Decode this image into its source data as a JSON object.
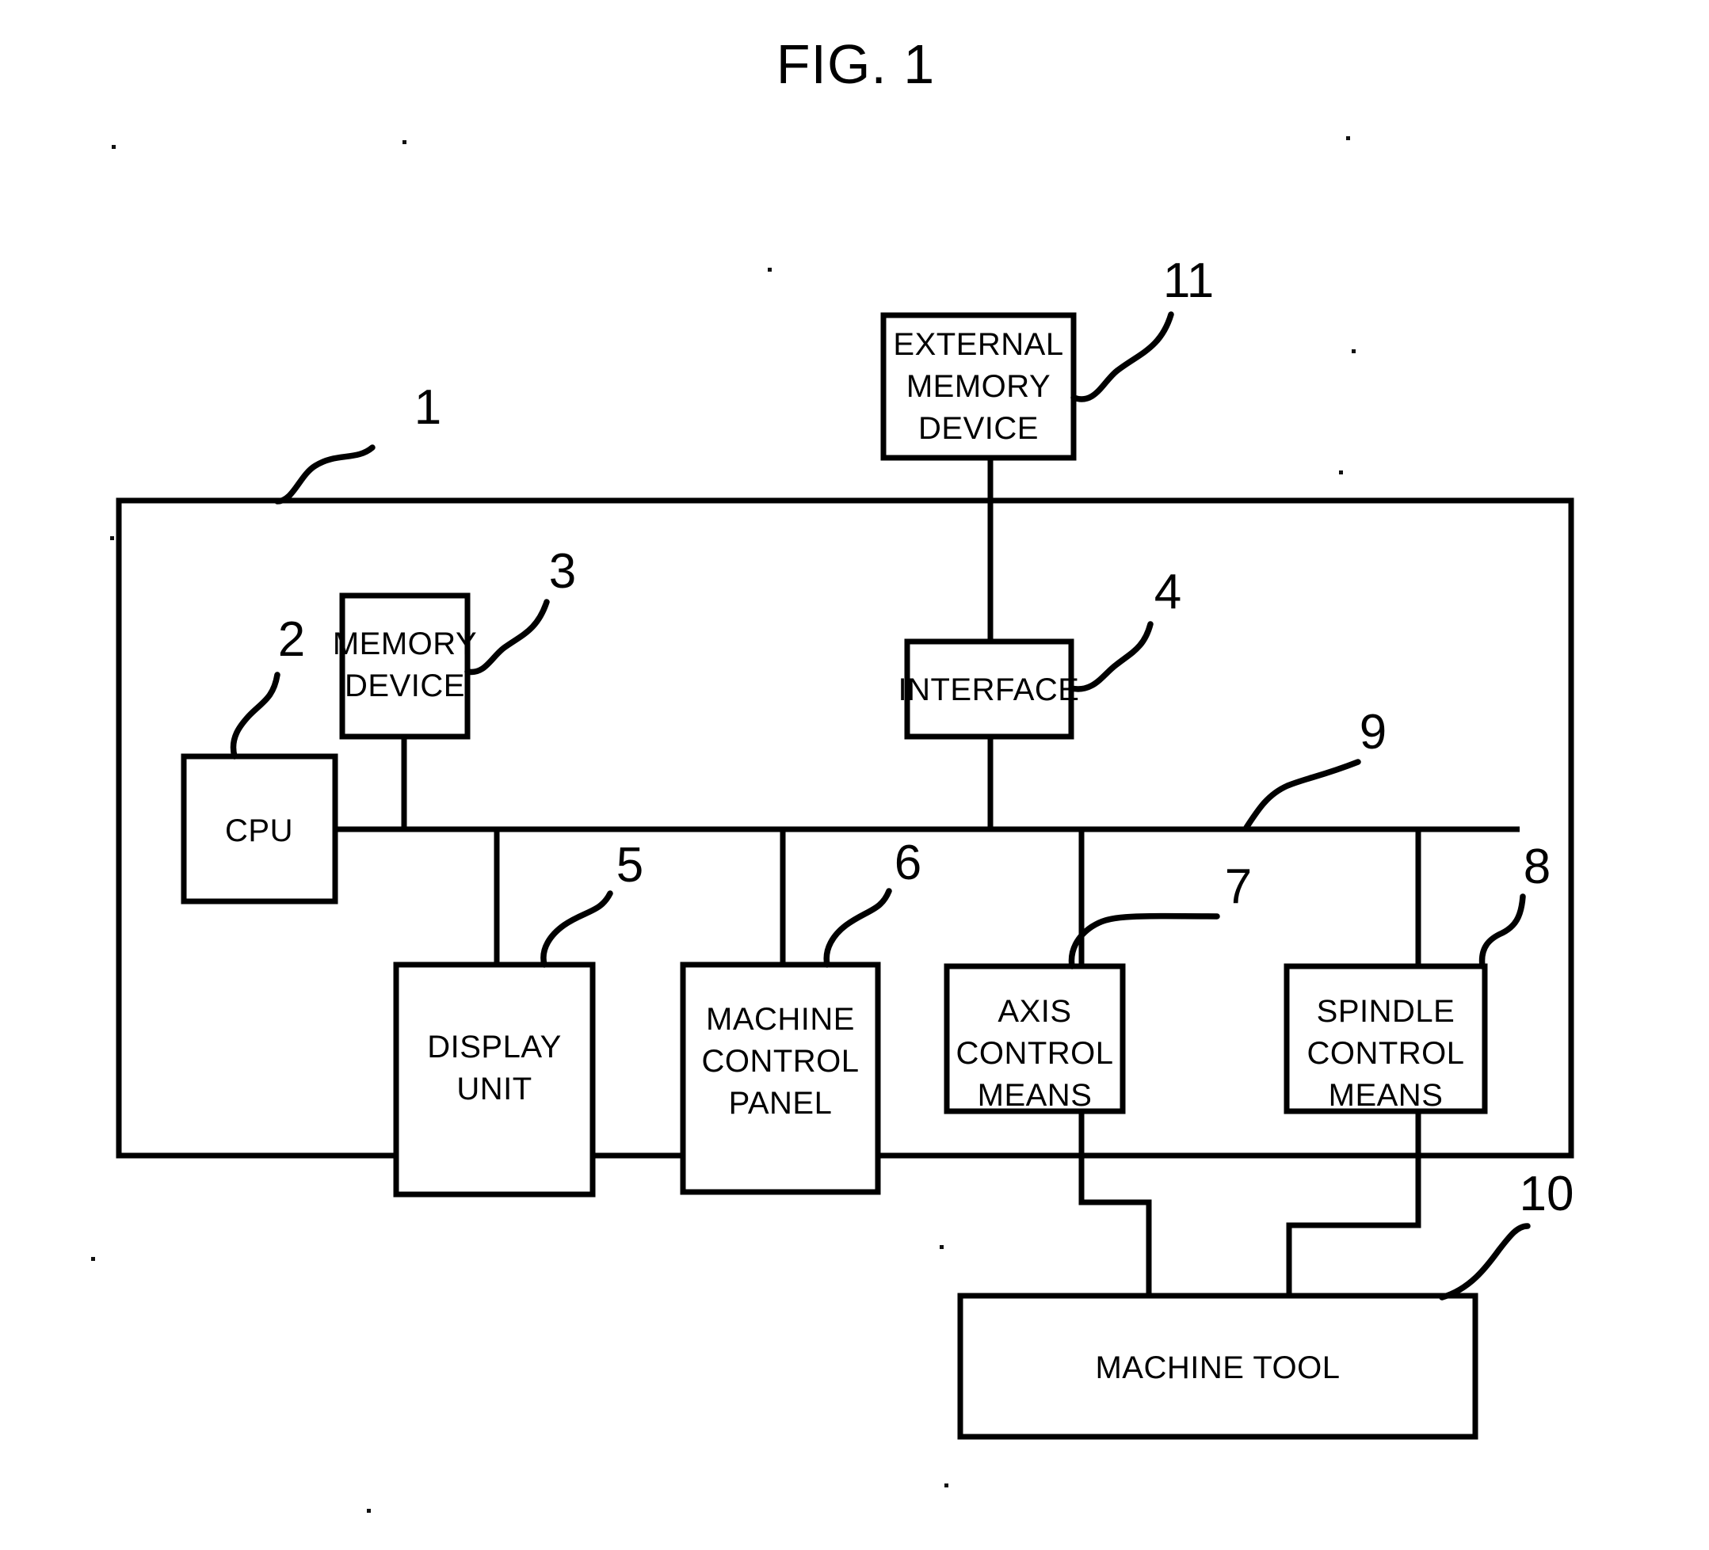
{
  "figure": {
    "title": "FIG. 1",
    "type": "patent-block-diagram",
    "description": "Numerical controller block diagram"
  },
  "enclosure": {
    "name": "numerical-controller",
    "ref": "1"
  },
  "blocks": [
    {
      "id": "external-memory-device",
      "ref": "11",
      "lines": [
        "EXTERNAL",
        "MEMORY",
        "DEVICE"
      ]
    },
    {
      "id": "cpu",
      "ref": "2",
      "lines": [
        "CPU"
      ]
    },
    {
      "id": "memory-device",
      "ref": "3",
      "lines": [
        "MEMORY",
        "DEVICE"
      ]
    },
    {
      "id": "interface",
      "ref": "4",
      "lines": [
        "INTERFACE"
      ]
    },
    {
      "id": "display-unit",
      "ref": "5",
      "lines": [
        "DISPLAY",
        "UNIT"
      ]
    },
    {
      "id": "machine-control-panel",
      "ref": "6",
      "lines": [
        "MACHINE",
        "CONTROL",
        "PANEL"
      ]
    },
    {
      "id": "axis-control-means",
      "ref": "7",
      "lines": [
        "AXIS",
        "CONTROL",
        "MEANS"
      ]
    },
    {
      "id": "spindle-control-means",
      "ref": "8",
      "lines": [
        "SPINDLE",
        "CONTROL",
        "MEANS"
      ]
    },
    {
      "id": "bus",
      "ref": "9",
      "lines": []
    },
    {
      "id": "machine-tool",
      "ref": "10",
      "lines": [
        "MACHINE TOOL"
      ]
    }
  ],
  "text": {
    "fig_title": "FIG. 1",
    "external_memory_l1": "EXTERNAL",
    "external_memory_l2": "MEMORY",
    "external_memory_l3": "DEVICE",
    "cpu": "CPU",
    "memory_device_l1": "MEMORY",
    "memory_device_l2": "DEVICE",
    "interface": "INTERFACE",
    "display_unit_l1": "DISPLAY",
    "display_unit_l2": "UNIT",
    "machine_control_panel_l1": "MACHINE",
    "machine_control_panel_l2": "CONTROL",
    "machine_control_panel_l3": "PANEL",
    "axis_control_l1": "AXIS",
    "axis_control_l2": "CONTROL",
    "axis_control_l3": "MEANS",
    "spindle_control_l1": "SPINDLE",
    "spindle_control_l2": "CONTROL",
    "spindle_control_l3": "MEANS",
    "machine_tool": "MACHINE TOOL"
  },
  "refs": {
    "enclosure": "1",
    "cpu": "2",
    "memory_device": "3",
    "interface": "4",
    "display_unit": "5",
    "machine_control_panel": "6",
    "axis_control_means": "7",
    "spindle_control_means": "8",
    "bus": "9",
    "machine_tool": "10",
    "external_memory_device": "11"
  },
  "colors": {
    "ink": "#000000",
    "paper": "#ffffff"
  }
}
